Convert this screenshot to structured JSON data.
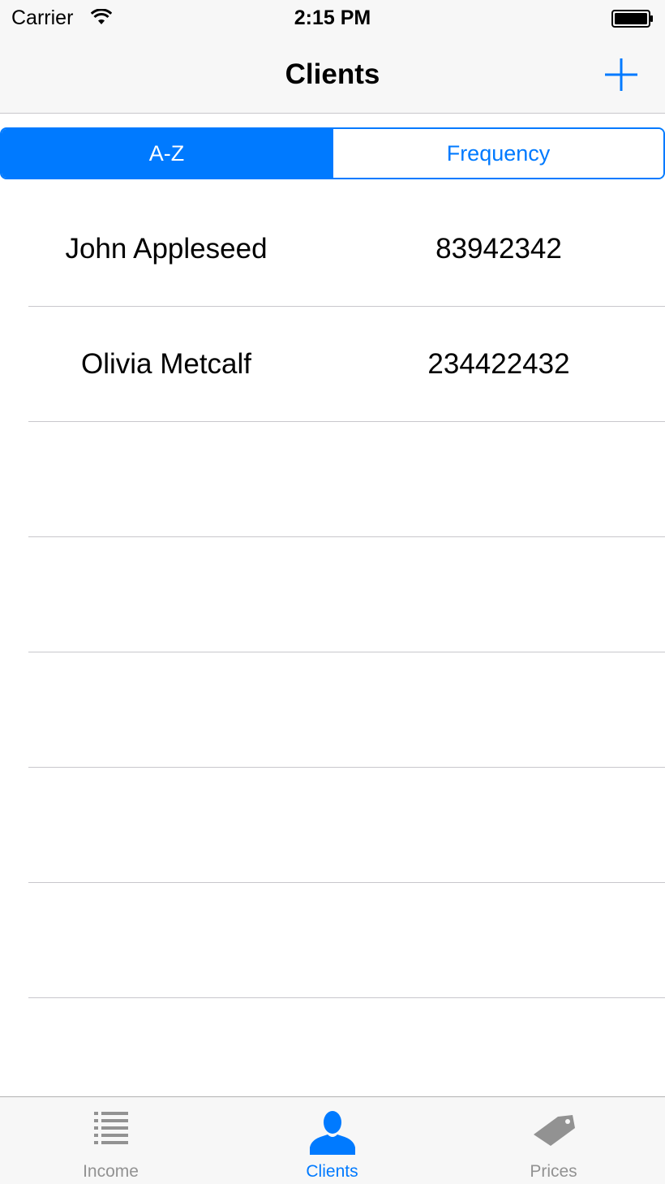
{
  "status_bar": {
    "carrier": "Carrier",
    "time": "2:15 PM"
  },
  "nav_bar": {
    "title": "Clients",
    "add_icon": "plus-icon"
  },
  "segmented_control": {
    "segments": [
      {
        "label": "A-Z",
        "selected": true
      },
      {
        "label": "Frequency",
        "selected": false
      }
    ]
  },
  "clients": [
    {
      "name": "John Appleseed",
      "number": "83942342"
    },
    {
      "name": "Olivia Metcalf",
      "number": "234422432"
    }
  ],
  "tab_bar": {
    "tabs": [
      {
        "label": "Income",
        "icon": "list-icon",
        "selected": false
      },
      {
        "label": "Clients",
        "icon": "person-icon",
        "selected": true
      },
      {
        "label": "Prices",
        "icon": "price-tag-icon",
        "selected": false
      }
    ]
  },
  "colors": {
    "accent": "#007aff",
    "inactive_tab": "#929292",
    "separator": "#c8c7cc",
    "bar_background": "#f7f7f7"
  }
}
